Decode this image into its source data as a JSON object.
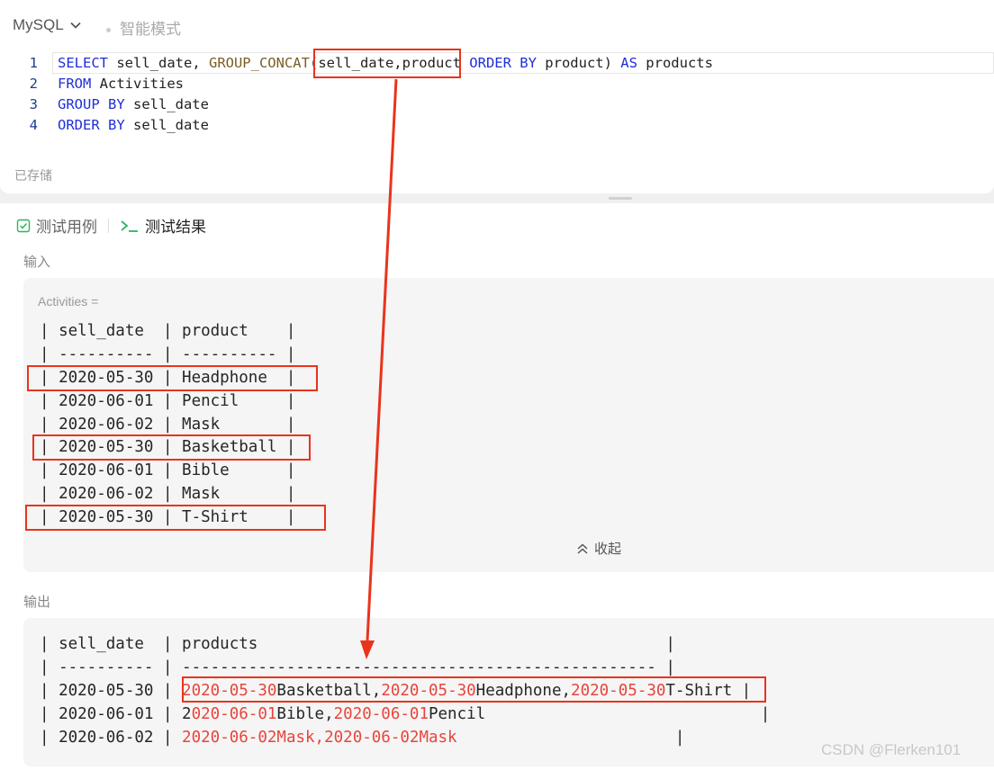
{
  "editor": {
    "language": "MySQL",
    "mode": "智能模式",
    "lines": [
      {
        "num": "1",
        "tokens": [
          {
            "t": "SELECT",
            "c": "kw"
          },
          {
            "t": " sell_date, ",
            "c": ""
          },
          {
            "t": "GROUP_CONCAT",
            "c": "fn"
          },
          {
            "t": "(",
            "c": ""
          },
          {
            "t": "sell_date,product",
            "c": ""
          },
          {
            "t": " ",
            "c": ""
          },
          {
            "t": "ORDER BY",
            "c": "kw"
          },
          {
            "t": " product) ",
            "c": ""
          },
          {
            "t": "AS",
            "c": "kw"
          },
          {
            "t": " products",
            "c": ""
          }
        ]
      },
      {
        "num": "2",
        "tokens": [
          {
            "t": "FROM",
            "c": "kw"
          },
          {
            "t": " Activities",
            "c": ""
          }
        ]
      },
      {
        "num": "3",
        "tokens": [
          {
            "t": "GROUP BY",
            "c": "kw"
          },
          {
            "t": " sell_date",
            "c": ""
          }
        ]
      },
      {
        "num": "4",
        "tokens": [
          {
            "t": "ORDER BY",
            "c": "kw"
          },
          {
            "t": " sell_date",
            "c": ""
          }
        ]
      }
    ],
    "status": "已存储"
  },
  "tabs": {
    "testcase": "测试用例",
    "result": "测试结果"
  },
  "input": {
    "label": "输入",
    "var_name": "Activities =",
    "rows": [
      "| sell_date  | product    |",
      "| ---------- | ---------- |",
      "| 2020-05-30 | Headphone  |",
      "| 2020-06-01 | Pencil     |",
      "| 2020-06-02 | Mask       |",
      "| 2020-05-30 | Basketball |",
      "| 2020-06-01 | Bible      |",
      "| 2020-06-02 | Mask       |",
      "| 2020-05-30 | T-Shirt    |"
    ],
    "collapse": "收起"
  },
  "output": {
    "label": "输出",
    "rows": [
      [
        {
          "t": "| sell_date  | products                                           |"
        }
      ],
      [
        {
          "t": "| ---------- | -------------------------------------------------- |"
        }
      ],
      [
        {
          "t": "| 2020-05-30 | "
        },
        {
          "t": "2020-05-30",
          "r": true
        },
        {
          "t": "Basketball,"
        },
        {
          "t": "2020-05-30",
          "r": true
        },
        {
          "t": "Headphone,"
        },
        {
          "t": "2020-05-30",
          "r": true
        },
        {
          "t": "T-Shirt |"
        }
      ],
      [
        {
          "t": "| 2020-06-01 | 2"
        },
        {
          "t": "020-06-01",
          "r": true
        },
        {
          "t": "Bible,"
        },
        {
          "t": "2020-06-01",
          "r": true
        },
        {
          "t": "Pencil                             |"
        }
      ],
      [
        {
          "t": "| 2020-06-02 | "
        },
        {
          "t": "2020-06-02Mask,2020-06-02Mask",
          "r": true
        },
        {
          "t": "                       |"
        }
      ]
    ]
  },
  "watermark": "CSDN @Flerken101",
  "colors": {
    "annotation": "#e8341c",
    "keyword": "#1f2fd8",
    "function": "#795e26",
    "highlight_text": "#e8453c"
  }
}
